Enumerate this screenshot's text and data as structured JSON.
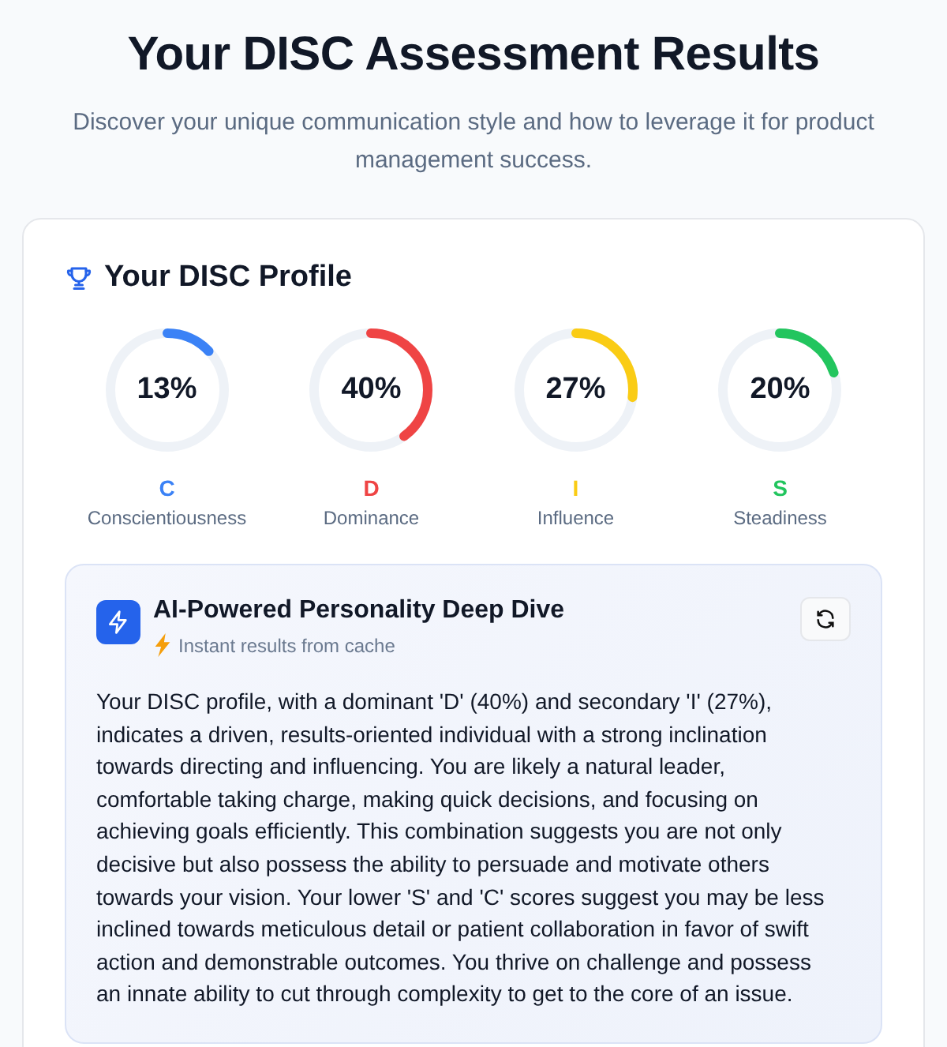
{
  "header": {
    "title": "Your DISC Assessment Results",
    "subtitle": "Discover your unique communication style and how to leverage it for product management success."
  },
  "profile": {
    "title": "Your DISC Profile",
    "scores": [
      {
        "percent": "13%",
        "level": 0.13,
        "letter": "C",
        "name": "Conscientiousness",
        "color": "#3b82f6"
      },
      {
        "percent": "40%",
        "level": 0.4,
        "letter": "D",
        "name": "Dominance",
        "color": "#ef4444"
      },
      {
        "percent": "27%",
        "level": 0.27,
        "letter": "I",
        "name": "Influence",
        "color": "#facc15"
      },
      {
        "percent": "20%",
        "level": 0.2,
        "letter": "S",
        "name": "Steadiness",
        "color": "#22c55e"
      }
    ]
  },
  "deep_dive": {
    "title": "AI-Powered Personality Deep Dive",
    "status": "Instant results from cache",
    "text": "Your DISC profile, with a dominant 'D' (40%) and secondary 'I' (27%), indicates a driven, results-oriented individual with a strong inclination towards directing and influencing. You are likely a natural leader, comfortable taking charge, making quick decisions, and focusing on achieving goals efficiently. This combination suggests you are not only decisive but also possess the ability to persuade and motivate others towards your vision. Your lower 'S' and 'C' scores suggest you may be less inclined towards meticulous detail or patient collaboration in favor of swift action and demonstrable outcomes. You thrive on challenge and possess an innate ability to cut through complexity to get to the core of an issue."
  }
}
